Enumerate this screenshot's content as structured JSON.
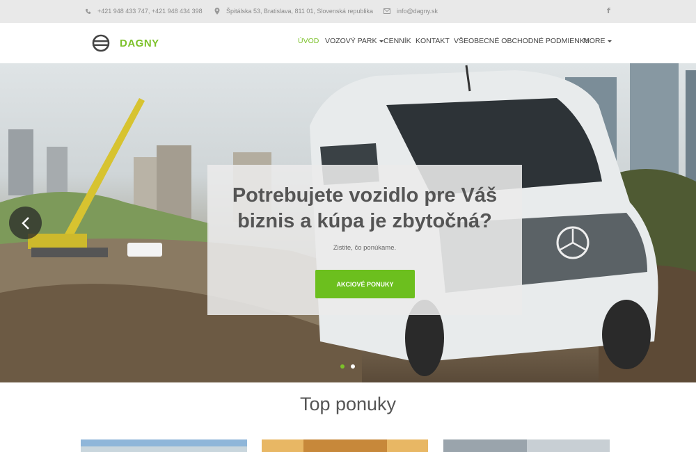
{
  "topbar": {
    "phone": "+421 948 433 747, +421 948 434 398",
    "address": "Špitálska 53, Bratislava, 811 01, Slovenská republika",
    "email": "info@dagny.sk",
    "facebook": "f"
  },
  "brand": {
    "name": "DAGNY",
    "color": "#7cc12a"
  },
  "nav": {
    "items": [
      {
        "label": "ÚVOD",
        "active": true
      },
      {
        "label": "VOZOVÝ PARK",
        "dropdown": true
      },
      {
        "label": "CENNÍK"
      },
      {
        "label": "KONTAKT"
      },
      {
        "label": "VŠEOBECNÉ OBCHODNÉ PODMIENKY"
      },
      {
        "label": "MORE",
        "dropdown": true
      }
    ]
  },
  "hero": {
    "heading_line1": "Potrebujete vozidlo pre Váš",
    "heading_line2": "biznis a kúpa je zbytočná?",
    "subtext": "Zistite, čo ponúkame.",
    "cta_label": "AKCIOVÉ PONUKY",
    "cta_color": "#6cbf1e",
    "slides": 2,
    "active_slide": 1
  },
  "section": {
    "title": "Top ponuky"
  },
  "icons": [
    "phone-icon",
    "map-marker-icon",
    "envelope-icon",
    "facebook-icon",
    "logo-icon",
    "chevron-left-icon"
  ]
}
